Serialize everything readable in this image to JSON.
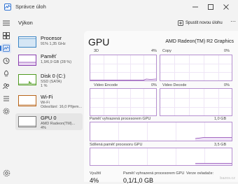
{
  "window": {
    "title": "Správce úloh"
  },
  "header": {
    "title": "Výkon",
    "run_task_label": "Spustit novou úlohu",
    "more_label": "⋯"
  },
  "sidebar": {
    "items": [
      {
        "name": "Procesor",
        "sub": "91% 1,35 GHz",
        "sub2": ""
      },
      {
        "name": "Paměť",
        "sub": "1,9/6,9 GB (28 %)",
        "sub2": ""
      },
      {
        "name": "Disk 0 (C:)",
        "sub": "SSD (SATA)",
        "sub2": "1 %"
      },
      {
        "name": "Wi-Fi",
        "sub": "Wi-Fi",
        "sub2": "Odesílání: 16,0 Přijem..."
      },
      {
        "name": "GPU 0",
        "sub": "AMD Radeon(TM)...",
        "sub2": "4%"
      }
    ]
  },
  "main": {
    "title": "GPU",
    "model": "AMD Radeon(TM) R2 Graphics",
    "graphs": [
      {
        "label": "3D",
        "value": "4%"
      },
      {
        "label": "Copy",
        "value": "0%"
      },
      {
        "label": "Video Encode",
        "value": "0%"
      },
      {
        "label": "Video Decode",
        "value": "0%"
      }
    ],
    "dedicated": {
      "label": "Paměť vyhrazená procesorem GPU",
      "max": "1,0 GB"
    },
    "shared": {
      "label": "Sdílená paměť procesoru GPU",
      "max": "3,5 GB"
    },
    "stats": [
      {
        "label": "Využití",
        "value": "4%"
      },
      {
        "label": "Paměť vyhrazená procesorem GPU",
        "value": "0,1/1,0 GB"
      },
      {
        "label": "Verze ovladače:",
        "value": ""
      }
    ]
  },
  "watermark": "bazos.cz",
  "colors": {
    "accent": "#2a6fd1",
    "gpu_graph": "#b58fd0",
    "cpu": "#3a84c4",
    "memory": "#8a3fb0",
    "disk": "#4f9a20",
    "wifi": "#b8651a"
  }
}
